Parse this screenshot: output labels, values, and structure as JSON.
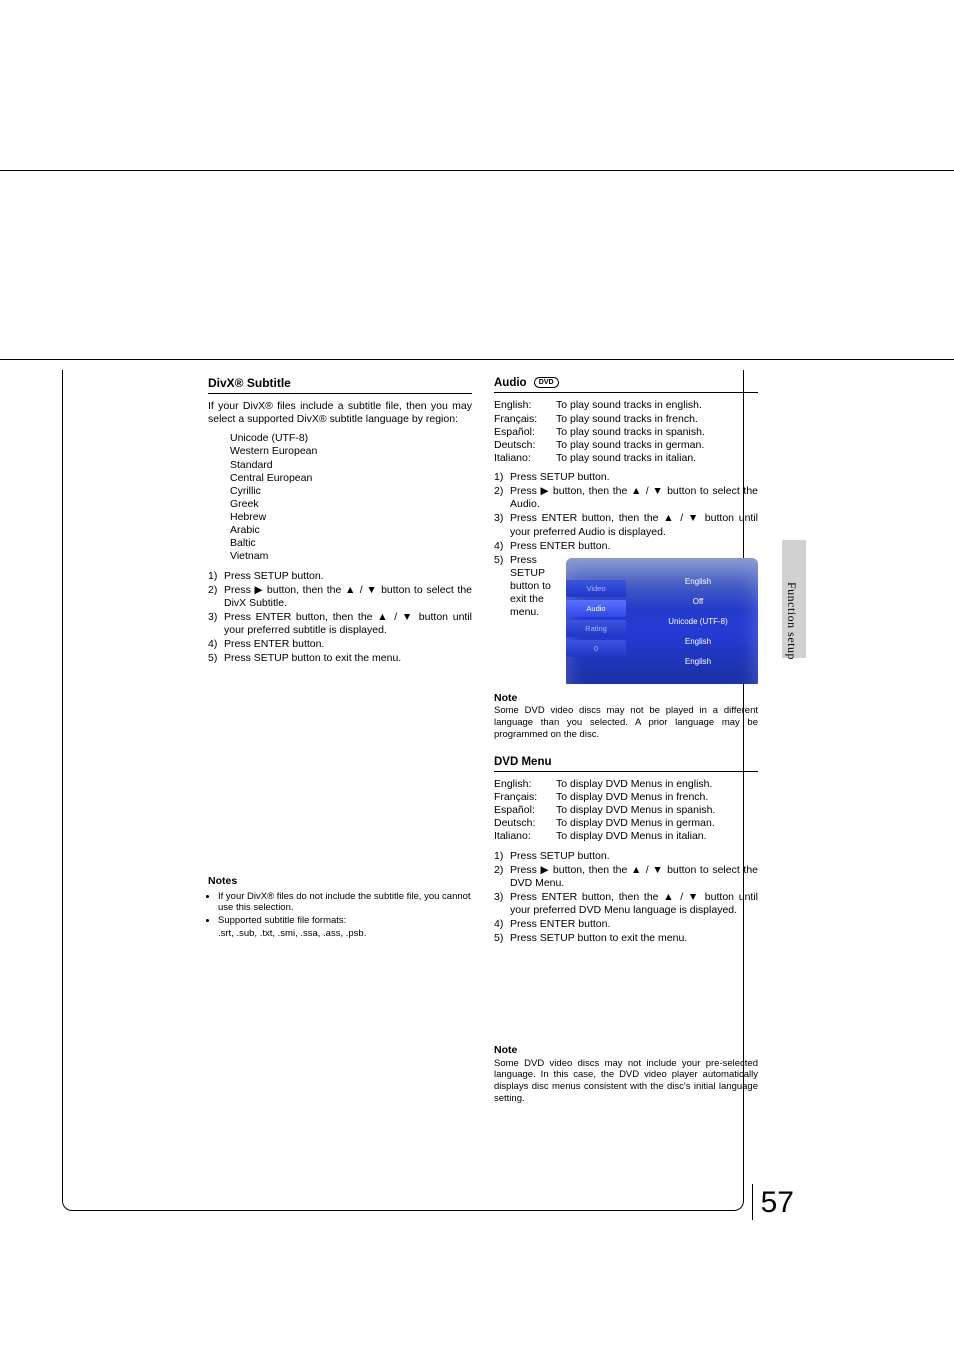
{
  "page_number": "57",
  "side_caption": "Function setup",
  "left": {
    "heading": "DivX® Subtitle",
    "intro1": "If your DivX® files include a subtitle file, then you may select a supported DivX® subtitle language by region:",
    "enc": [
      "Unicode (UTF-8)",
      "Western European",
      "Standard",
      "Central European",
      "Cyrillic",
      "Greek",
      "Hebrew",
      "Arabic",
      "Baltic",
      "Vietnam"
    ],
    "steps": [
      "Press SETUP button.",
      "Press ▶ button, then the ▲ / ▼ button to select the DivX Subtitle.",
      "Press ENTER button, then the ▲ / ▼ button until your preferred subtitle is displayed.",
      "Press ENTER button.",
      "Press SETUP button to exit the menu."
    ],
    "notes_h": "Notes",
    "notes": [
      "If your DivX® files do not include the subtitle file, you cannot use this selection.",
      "Supported subtitle file formats:",
      ".srt, .sub, .txt, .smi, .ssa, .ass, .psb."
    ]
  },
  "audio": {
    "heading": "Audio",
    "badge": "DVD",
    "langs": [
      [
        "English:",
        "To play sound tracks in english."
      ],
      [
        "Français:",
        "To play sound tracks in french."
      ],
      [
        "Español:",
        "To play sound tracks in spanish."
      ],
      [
        "Deutsch:",
        "To play sound tracks in german."
      ],
      [
        "Italiano:",
        "To play sound tracks in italian."
      ]
    ],
    "steps": [
      "Press SETUP button.",
      "Press ▶ button, then the ▲ / ▼ button to select the Audio.",
      "Press ENTER button, then the ▲ / ▼ button until your preferred Audio is displayed.",
      "Press ENTER button.",
      "Press SETUP button to exit the menu."
    ],
    "note_h": "Note",
    "note": "Some DVD video discs may not be played in a different language than you selected. A prior language may be programmed on the disc.",
    "menu": {
      "tabs": [
        "Video",
        "Audio",
        "Rating",
        "0"
      ],
      "vals": [
        "English",
        "Off",
        "Unicode (UTF-8)",
        "English",
        "English"
      ]
    }
  },
  "dvdmenu": {
    "heading": "DVD Menu",
    "langs": [
      [
        "English:",
        "To display DVD Menus in english."
      ],
      [
        "Français:",
        "To display DVD Menus in french."
      ],
      [
        "Español:",
        "To display DVD Menus in spanish."
      ],
      [
        "Deutsch:",
        "To display DVD Menus in german."
      ],
      [
        "Italiano:",
        "To display DVD Menus in italian."
      ]
    ],
    "steps": [
      "Press SETUP button.",
      "Press ▶ button, then the ▲ / ▼ button to select the DVD Menu.",
      "Press ENTER button, then the ▲ / ▼ button until your preferred DVD Menu language is displayed.",
      "Press ENTER button.",
      "Press SETUP button to exit the menu."
    ],
    "note_h": "Note",
    "note": "Some DVD video discs may not include your pre-selected language. In this case, the DVD video player automatically displays disc menus consistent with the disc's initial language setting."
  }
}
